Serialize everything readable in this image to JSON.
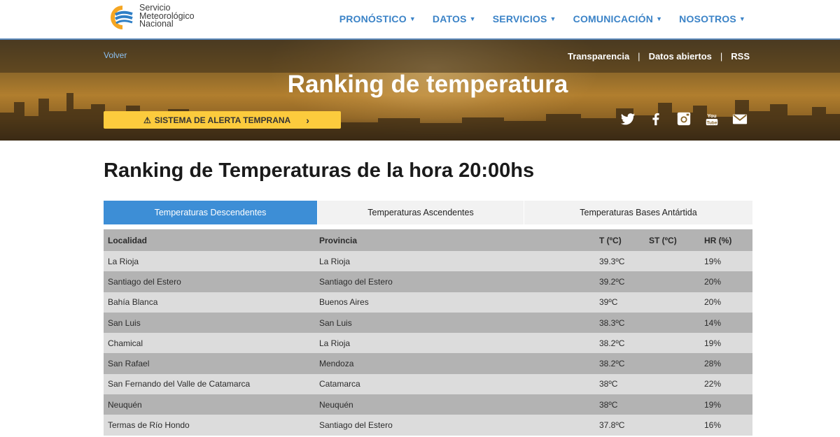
{
  "brand": {
    "logo_text_1": "Servicio",
    "logo_text_2": "Meteorológico",
    "logo_text_3": "Nacional"
  },
  "nav": [
    {
      "label": "PRONÓSTICO"
    },
    {
      "label": "DATOS"
    },
    {
      "label": "SERVICIOS"
    },
    {
      "label": "COMUNICACIÓN"
    },
    {
      "label": "NOSOTROS"
    }
  ],
  "hero": {
    "back_link": "Volver",
    "links": [
      "Transparencia",
      "Datos abiertos",
      "RSS"
    ],
    "title": "Ranking de temperatura",
    "alert_button": "SISTEMA DE ALERTA TEMPRANA",
    "social_icons": [
      "twitter-icon",
      "facebook-icon",
      "instagram-icon",
      "youtube-icon",
      "mail-icon"
    ]
  },
  "content": {
    "page_title": "Ranking de Temperaturas de la hora 20:00hs",
    "tabs": [
      "Temperaturas Descendentes",
      "Temperaturas Ascendentes",
      "Temperaturas Bases Antártida"
    ],
    "active_tab": 0,
    "columns": [
      "Localidad",
      "Provincia",
      "T (ºC)",
      "ST (ºC)",
      "HR (%)"
    ],
    "rows": [
      [
        "La Rioja",
        "La Rioja",
        "39.3ºC",
        "",
        "19%"
      ],
      [
        "Santiago del Estero",
        "Santiago del Estero",
        "39.2ºC",
        "",
        "20%"
      ],
      [
        "Bahía Blanca",
        "Buenos Aires",
        "39ºC",
        "",
        "20%"
      ],
      [
        "San Luis",
        "San Luis",
        "38.3ºC",
        "",
        "14%"
      ],
      [
        "Chamical",
        "La Rioja",
        "38.2ºC",
        "",
        "19%"
      ],
      [
        "San Rafael",
        "Mendoza",
        "38.2ºC",
        "",
        "28%"
      ],
      [
        "San Fernando del Valle de Catamarca",
        "Catamarca",
        "38ºC",
        "",
        "22%"
      ],
      [
        "Neuquén",
        "Neuquén",
        "38ºC",
        "",
        "19%"
      ],
      [
        "Termas de Río Hondo",
        "Santiago del Estero",
        "37.8ºC",
        "",
        "16%"
      ]
    ]
  },
  "colors": {
    "nav_text": "#3b83c7",
    "active_tab": "#3d8ed6",
    "alert_yellow": "#fccb3d",
    "logo_blue": "#2f7fc6",
    "logo_orange": "#f5a623"
  }
}
